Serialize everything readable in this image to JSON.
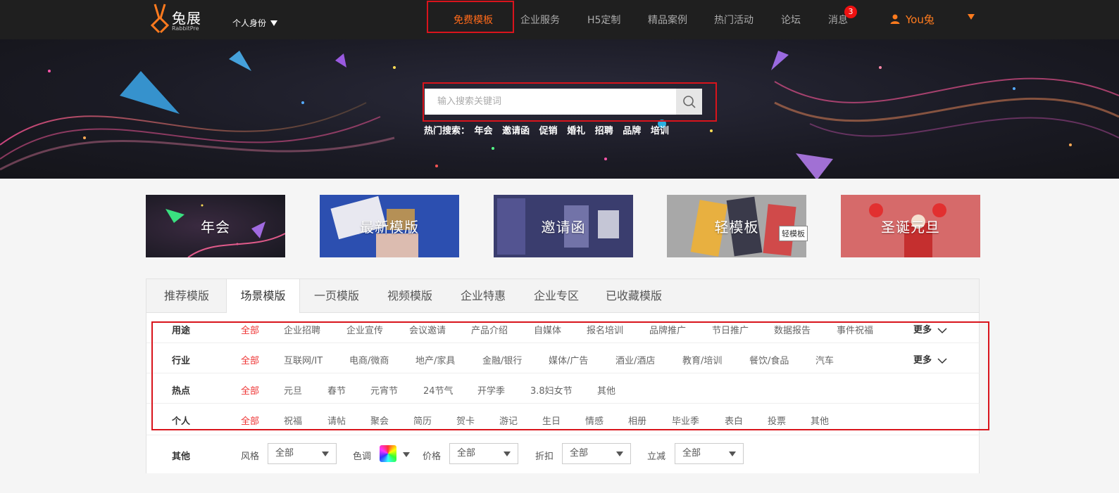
{
  "header": {
    "logo_name": "兔展",
    "logo_sub": "RabbitPre",
    "identity": "个人身份",
    "nav": [
      "免费模板",
      "企业服务",
      "H5定制",
      "精品案例",
      "热门活动",
      "论坛",
      "消息"
    ],
    "message_count": "3",
    "user": "You兔"
  },
  "search": {
    "placeholder": "输入搜索关键词",
    "hot_label": "热门搜索：",
    "hot_terms": [
      "年会",
      "邀请函",
      "促销",
      "婚礼",
      "招聘",
      "品牌",
      "培训"
    ]
  },
  "cards": [
    "年会",
    "最新模版",
    "邀请函",
    "轻模板",
    "圣诞元旦"
  ],
  "tooltip": "轻模板",
  "tabs": [
    "推荐模版",
    "场景模版",
    "一页模版",
    "视频模版",
    "企业特惠",
    "企业专区",
    "已收藏模版"
  ],
  "filters": {
    "purpose": {
      "label": "用途",
      "options": [
        "全部",
        "企业招聘",
        "企业宣传",
        "会议邀请",
        "产品介绍",
        "自媒体",
        "报名培训",
        "品牌推广",
        "节日推广",
        "数据报告",
        "事件祝福"
      ],
      "more": "更多"
    },
    "industry": {
      "label": "行业",
      "options": [
        "全部",
        "互联网/IT",
        "电商/微商",
        "地产/家具",
        "金融/银行",
        "媒体/广告",
        "酒业/酒店",
        "教育/培训",
        "餐饮/食品",
        "汽车"
      ],
      "more": "更多"
    },
    "hot": {
      "label": "热点",
      "options": [
        "全部",
        "元旦",
        "春节",
        "元宵节",
        "24节气",
        "开学季",
        "3.8妇女节",
        "其他"
      ]
    },
    "personal": {
      "label": "个人",
      "options": [
        "全部",
        "祝福",
        "请帖",
        "聚会",
        "简历",
        "贺卡",
        "游记",
        "生日",
        "情感",
        "相册",
        "毕业季",
        "表白",
        "投票",
        "其他"
      ]
    }
  },
  "other": {
    "label": "其他",
    "style_label": "风格",
    "style_value": "全部",
    "color_label": "色调",
    "price_label": "价格",
    "price_value": "全部",
    "discount_label": "折扣",
    "discount_value": "全部",
    "reduce_label": "立减",
    "reduce_value": "全部"
  },
  "colors": {
    "accent": "#ff6a1a",
    "active_option": "#e33333",
    "highlight_box": "#d9141c"
  }
}
